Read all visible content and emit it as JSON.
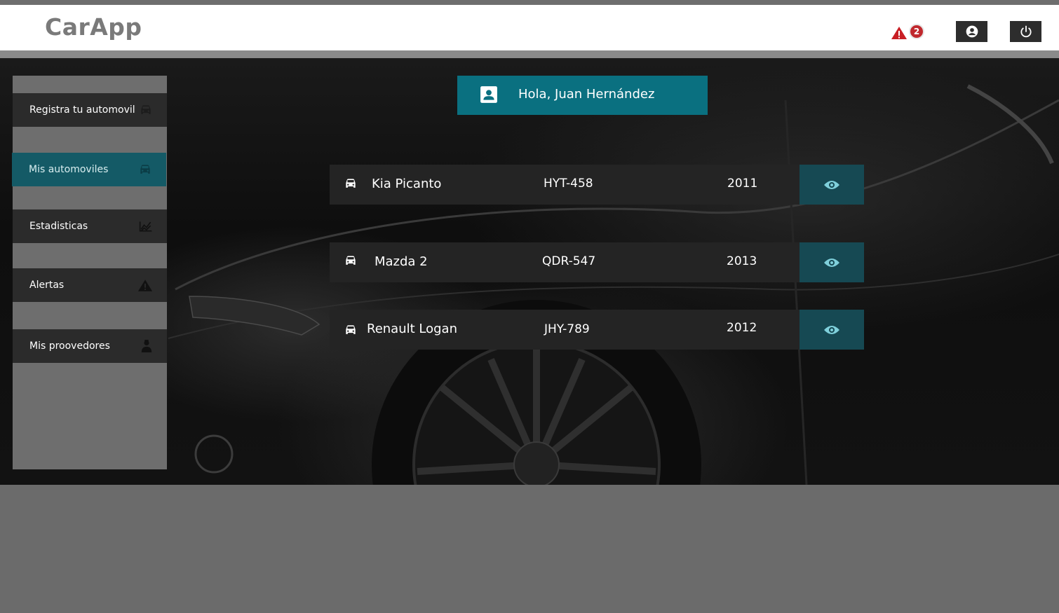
{
  "app": {
    "logo": "CarApp"
  },
  "header": {
    "alert_icon": "warning-icon",
    "alert_count": "2",
    "user_icon": "account-circle-icon",
    "power_icon": "power-icon"
  },
  "sidebar": {
    "items": [
      {
        "label": "Registra tu automovil",
        "icon": "car-icon"
      },
      {
        "label": "Mis automoviles",
        "icon": "car-icon",
        "active": true
      },
      {
        "label": "Estadisticas",
        "icon": "line-chart-icon"
      },
      {
        "label": "Alertas",
        "icon": "warning-icon"
      },
      {
        "label": "Mis proovedores",
        "icon": "person-icon"
      }
    ]
  },
  "greeting": {
    "text": "Hola, Juan Hernández",
    "icon": "contact-card-icon"
  },
  "cars": [
    {
      "name": "Kia Picanto",
      "plate": "HYT-458",
      "year": "2011"
    },
    {
      "name": "Mazda 2",
      "plate": "QDR-547",
      "year": "2013"
    },
    {
      "name": "Renault Logan",
      "plate": "JHY-789",
      "year": "2012"
    }
  ],
  "colors": {
    "accent": "#0a7080",
    "active_sidebar": "#145a66",
    "view_button": "#164953",
    "alert_red": "#c0282d"
  }
}
